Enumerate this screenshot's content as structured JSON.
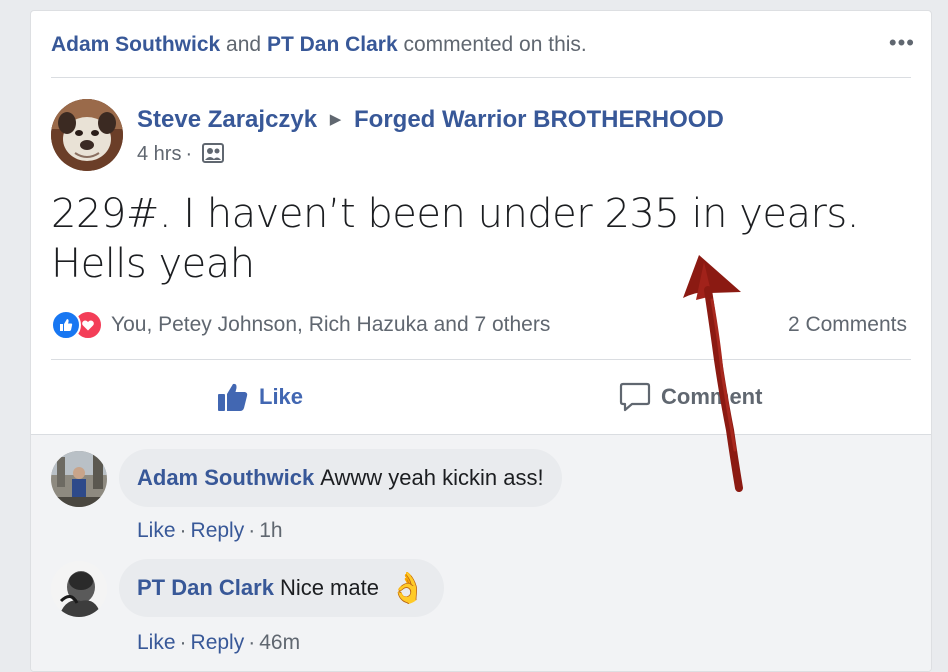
{
  "activity": {
    "name1": "Adam Southwick",
    "joiner": "and",
    "name2": "PT Dan Clark",
    "suffix": "commented on this.",
    "more_label": "•••"
  },
  "post": {
    "author": "Steve Zarajczyk",
    "group": "Forged Warrior BROTHERHOOD",
    "time": "4 hrs",
    "separator": "·",
    "audience_icon": "group-photo-icon",
    "text": "229#. I haven’t been under 235 in years. Hells yeah"
  },
  "reactions": {
    "icons": [
      "like",
      "love"
    ],
    "summary": "You, Petey Johnson, Rich Hazuka and 7 others",
    "comment_count": "2 Comments"
  },
  "actions": {
    "like": "Like",
    "comment": "Comment"
  },
  "comments": [
    {
      "author": "Adam Southwick",
      "text": "Awww yeah kickin ass!",
      "like": "Like",
      "reply": "Reply",
      "dot": "·",
      "time": "1h"
    },
    {
      "author": "PT Dan Clark",
      "text": "Nice mate",
      "emoji": "👌",
      "like": "Like",
      "reply": "Reply",
      "dot": "·",
      "time": "46m"
    }
  ],
  "colors": {
    "link": "#385898",
    "secondary": "#606770",
    "like_blue": "#4267b2",
    "annotation_arrow": "#8b1a12"
  }
}
